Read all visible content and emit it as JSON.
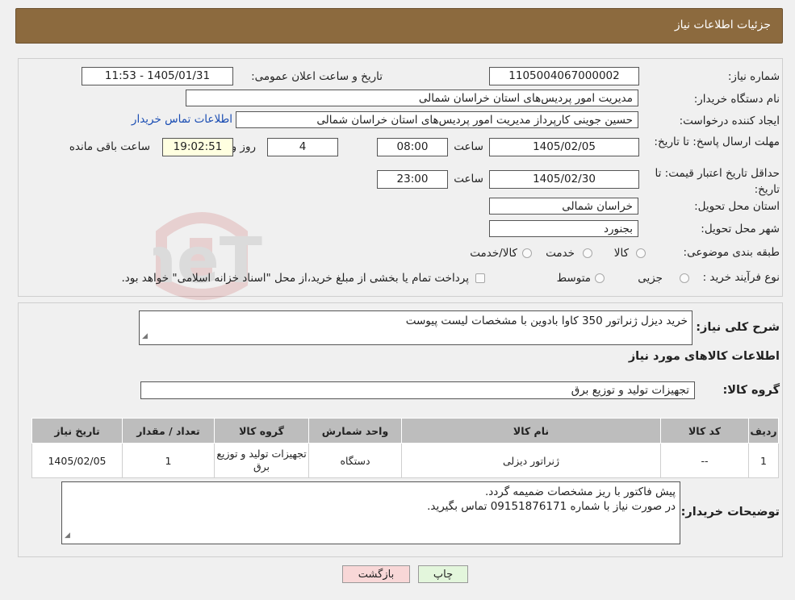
{
  "header": {
    "title": "جزئیات اطلاعات نیاز"
  },
  "details": {
    "need_number_label": "شماره نیاز:",
    "need_number": "1105004067000002",
    "announce_label": "تاریخ و ساعت اعلان عمومی:",
    "announce_value": "1405/01/31 - 11:53",
    "buyer_org_label": "نام دستگاه خریدار:",
    "buyer_org": "مدیریت امور پردیس‌های استان خراسان شمالی",
    "creator_label": "ایجاد کننده درخواست:",
    "creator": "حسین جوینی کارپرداز مدیریت امور پردیس‌های استان خراسان شمالی",
    "contact_link": "اطلاعات تماس خریدار",
    "deadline_label": "مهلت ارسال پاسخ: تا تاریخ:",
    "deadline_date": "1405/02/05",
    "time_label": "ساعت",
    "deadline_time": "08:00",
    "days_value": "4",
    "days_label": "روز و",
    "remaining_time": "19:02:51",
    "remaining_label": "ساعت باقی مانده",
    "validity_label": "حداقل تاریخ اعتبار قیمت: تا تاریخ:",
    "validity_date": "1405/02/30",
    "validity_time": "23:00",
    "province_label": "استان محل تحویل:",
    "province": "خراسان شمالی",
    "city_label": "شهر محل تحویل:",
    "city": "بجنورد",
    "category_label": "طبقه بندی موضوعی:",
    "category_options": [
      "کالا",
      "خدمت",
      "کالا/خدمت"
    ],
    "process_label": "نوع فرآیند خرید :",
    "process_options": [
      "جزیی",
      "متوسط"
    ],
    "process_note": "پرداخت تمام یا بخشی از مبلغ خرید،از محل \"اسناد خزانه اسلامی\" خواهد بود."
  },
  "summary": {
    "desc_label": "شرح کلی نیاز:",
    "desc_value": "خرید دیزل ژنراتور 350 کاوا بادوین با مشخصات لیست پیوست",
    "items_title": "اطلاعات کالاهای مورد نیاز",
    "group_label": "گروه کالا:",
    "group_value": "تجهیزات تولید و توزیع برق",
    "table": {
      "headers": [
        "ردیف",
        "کد کالا",
        "نام کالا",
        "واحد شمارش",
        "گروه کالا",
        "تعداد / مقدار",
        "تاریخ نیاز"
      ],
      "rows": [
        [
          "1",
          "--",
          "ژنراتور دیزلی",
          "دستگاه",
          "تجهیزات تولید و توزیع برق",
          "1",
          "1405/02/05"
        ]
      ]
    },
    "notes_label": "توضیحات خریدار:",
    "notes_line1": "پیش فاکتور با ریز مشخصات ضمیمه گردد.",
    "notes_line2": "در صورت نیاز با شماره 09151876171 تماس بگیرید."
  },
  "buttons": {
    "print": "چاپ",
    "back": "بازگشت"
  },
  "watermark": "AriaTender.neT",
  "colors": {
    "header": "#8c6a3e",
    "back_button": "#f8d7d7",
    "print_button": "#e3f6dc",
    "link": "#1a4db3"
  }
}
